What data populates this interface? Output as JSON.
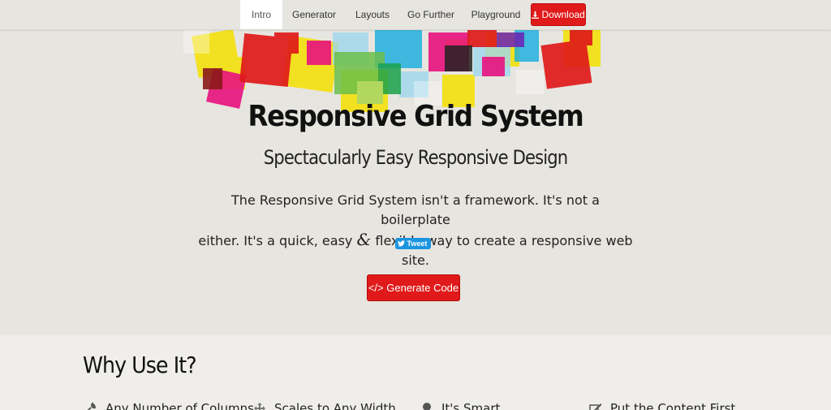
{
  "nav": {
    "items": [
      {
        "label": "Intro",
        "active": true
      },
      {
        "label": "Generator",
        "active": false
      },
      {
        "label": "Layouts",
        "active": false
      },
      {
        "label": "Go Further",
        "active": false
      },
      {
        "label": "Playground",
        "active": false
      }
    ],
    "download_label": "Download",
    "download_icon": "download-icon"
  },
  "hero": {
    "title": "Responsive Grid System",
    "subtitle": "Spectacularly Easy Responsive Design",
    "intro_line1": "The Responsive Grid System isn't a framework. It's not a boilerplate",
    "intro_line2_pre": "either. It's a quick, easy ",
    "intro_amp": "&",
    "intro_line2_post": " flexible way to create a responsive web site.",
    "tweet_label": "Tweet",
    "generate_label": "Generate Code",
    "generate_icon": "code-icon"
  },
  "why": {
    "title": "Why Use It?",
    "features": [
      {
        "label": "Any Number of Columns",
        "icon": "wrench-icon"
      },
      {
        "label": "Scales to Any Width",
        "icon": "resize-icon"
      },
      {
        "label": "It's Smart",
        "icon": "lightbulb-icon"
      },
      {
        "label": "Put the Content First",
        "icon": "edit-icon"
      }
    ]
  },
  "colors": {
    "accent_red": "#e01a1a",
    "twitter_blue": "#1b95e0",
    "mosaic": [
      "#f5e100",
      "#e8127f",
      "#e01a1a",
      "#15aee0",
      "#6cc04a",
      "#222222",
      "#6a1fb5"
    ]
  }
}
